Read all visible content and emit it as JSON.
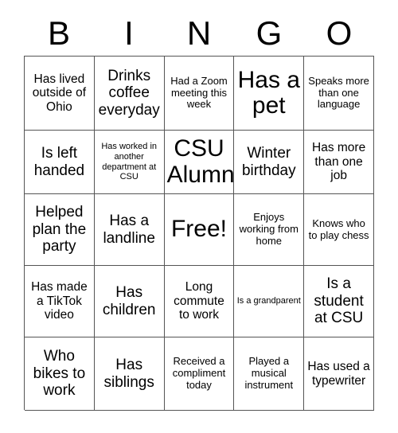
{
  "card": {
    "title_letters": [
      "B",
      "I",
      "N",
      "G",
      "O"
    ],
    "rows": [
      [
        {
          "text": "Has lived outside of Ohio",
          "size": "md"
        },
        {
          "text": "Drinks coffee everyday",
          "size": "lg"
        },
        {
          "text": "Had a Zoom meeting this week",
          "size": "sm"
        },
        {
          "text": "Has a pet",
          "size": "xl"
        },
        {
          "text": "Speaks more than one language",
          "size": "sm"
        }
      ],
      [
        {
          "text": "Is left handed",
          "size": "lg"
        },
        {
          "text": "Has worked in another department at CSU",
          "size": "xs"
        },
        {
          "text": "CSU Alumni",
          "size": "xl"
        },
        {
          "text": "Winter birthday",
          "size": "lg"
        },
        {
          "text": "Has more than one job",
          "size": "md"
        }
      ],
      [
        {
          "text": "Helped plan the party",
          "size": "lg"
        },
        {
          "text": "Has a landline",
          "size": "lg"
        },
        {
          "text": "Free!",
          "size": "xl"
        },
        {
          "text": "Enjoys working from home",
          "size": "sm"
        },
        {
          "text": "Knows who to play chess",
          "size": "sm"
        }
      ],
      [
        {
          "text": "Has made a TikTok video",
          "size": "md"
        },
        {
          "text": "Has children",
          "size": "lg"
        },
        {
          "text": "Long commute to work",
          "size": "md"
        },
        {
          "text": "Is a grandparent",
          "size": "xs"
        },
        {
          "text": "Is a student at CSU",
          "size": "lg"
        }
      ],
      [
        {
          "text": "Who bikes to work",
          "size": "lg"
        },
        {
          "text": "Has siblings",
          "size": "lg"
        },
        {
          "text": "Received a compliment today",
          "size": "sm"
        },
        {
          "text": "Played a musical instrument",
          "size": "sm"
        },
        {
          "text": "Has used a typewriter",
          "size": "md"
        }
      ]
    ]
  },
  "colors": {
    "background": "#ffffff",
    "text": "#000000",
    "grid_line": "#555555"
  }
}
